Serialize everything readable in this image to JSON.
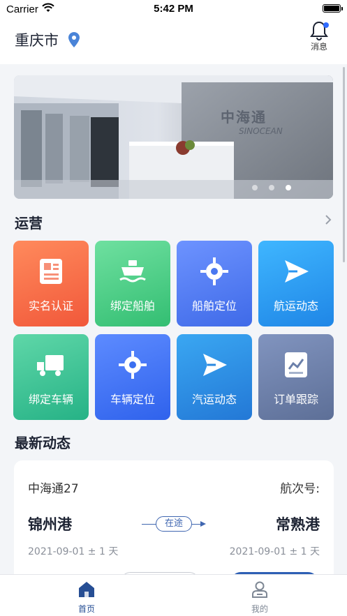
{
  "status_bar": {
    "carrier": "Carrier",
    "time": "5:42 PM"
  },
  "header": {
    "city": "重庆市",
    "messages_label": "消息"
  },
  "banner": {
    "sign_text": "中海通",
    "sign_sub": "SINOCEAN",
    "slides": 3,
    "active_slide": 3
  },
  "operations": {
    "title": "运营",
    "tiles": [
      {
        "label": "实名认证",
        "icon": "id-card-icon",
        "color": "#f4613f"
      },
      {
        "label": "绑定船舶",
        "icon": "ship-icon",
        "color": "#3fc97a"
      },
      {
        "label": "船舶定位",
        "icon": "locate-icon",
        "color": "#4a78f0"
      },
      {
        "label": "航运动态",
        "icon": "send-icon",
        "color": "#2a95f0"
      },
      {
        "label": "绑定车辆",
        "icon": "truck-icon",
        "color": "#2dbb8d"
      },
      {
        "label": "车辆定位",
        "icon": "locate-icon",
        "color": "#3b6ff0"
      },
      {
        "label": "汽运动态",
        "icon": "send-icon",
        "color": "#2a88e0"
      },
      {
        "label": "订单跟踪",
        "icon": "chart-icon",
        "color": "#6b80aa"
      }
    ]
  },
  "news": {
    "title": "最新动态",
    "card": {
      "ship": "中海通27",
      "voyage_label": "航次号:",
      "from_port": "锦州港",
      "to_port": "常熟港",
      "status": "在途",
      "from_date": "2021-09-01 ± 1 天",
      "to_date": "2021-09-01 ± 1 天"
    }
  },
  "tabbar": {
    "home": "首页",
    "mine": "我的"
  },
  "colors": {
    "accent": "#264e94",
    "tab_inactive": "#7e8794"
  }
}
